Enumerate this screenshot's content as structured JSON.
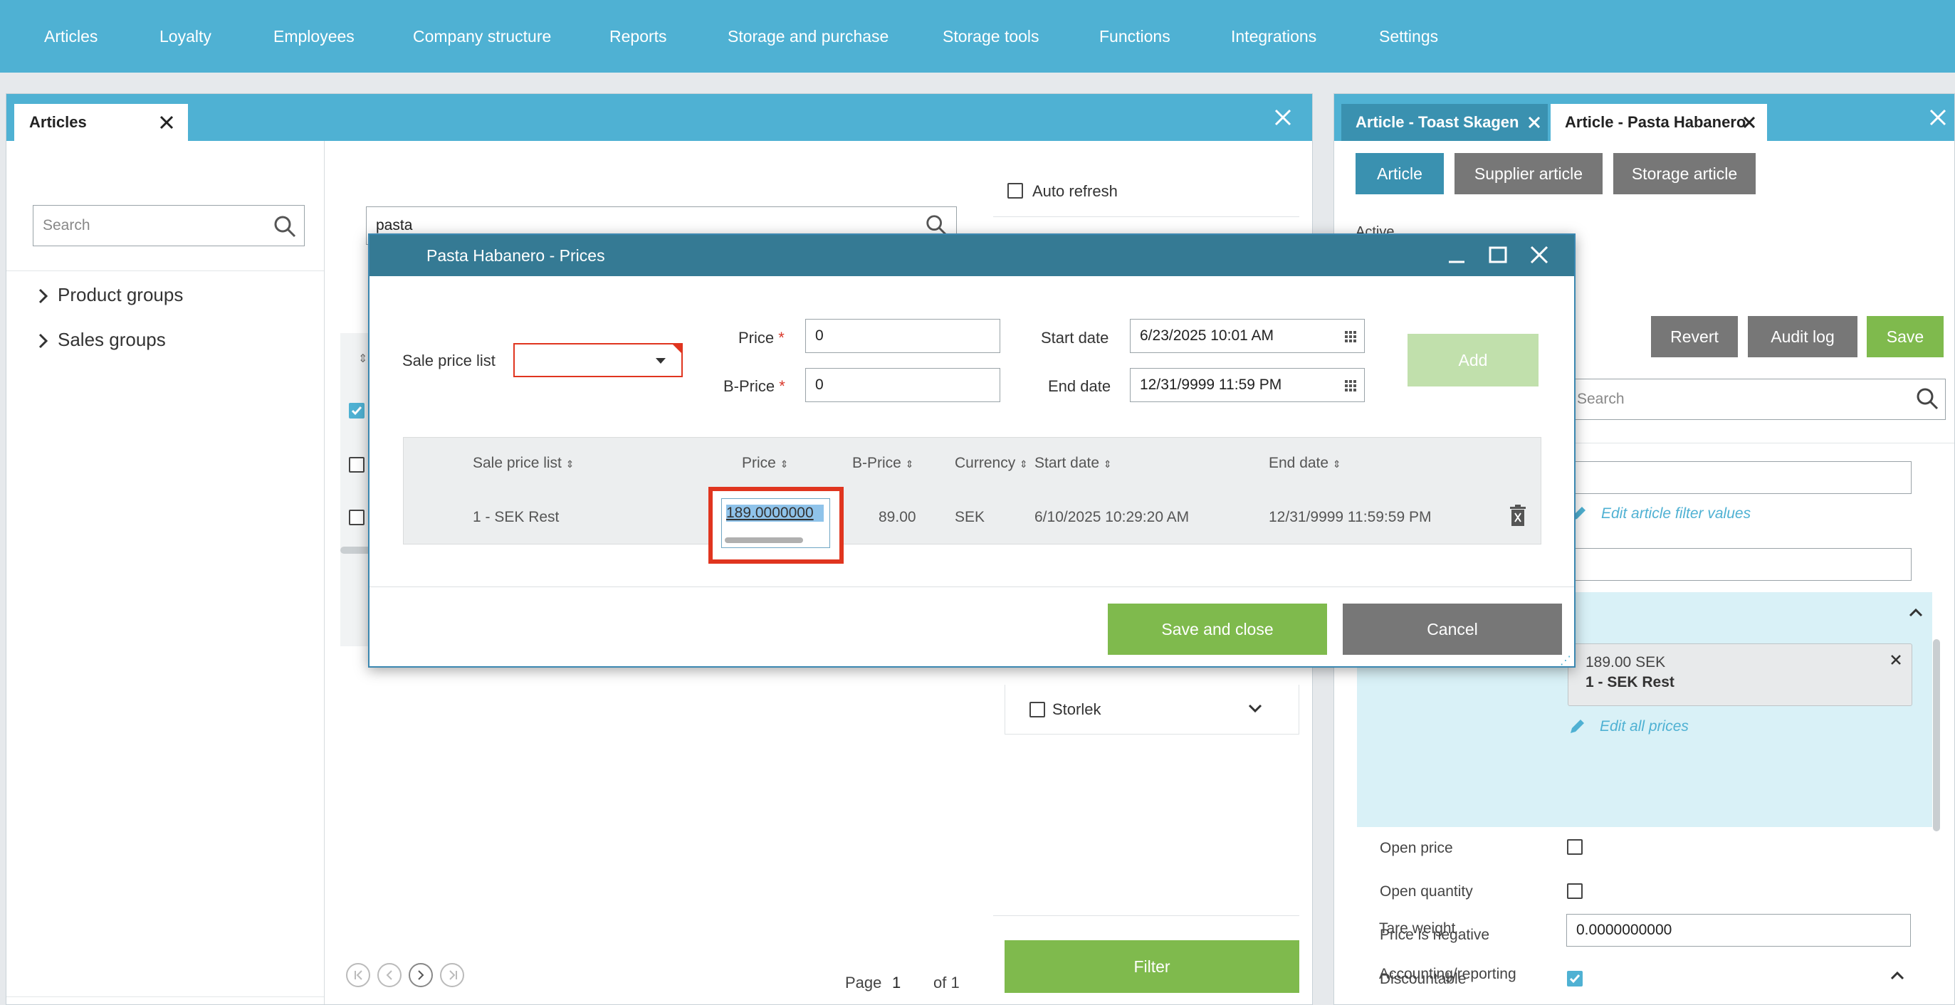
{
  "nav": [
    "Articles",
    "Loyalty",
    "Employees",
    "Company structure",
    "Reports",
    "Storage and purchase",
    "Storage tools",
    "Functions",
    "Integrations",
    "Settings"
  ],
  "left_panel": {
    "tab": "Articles",
    "tree_search_placeholder": "Search",
    "tree": [
      "Product groups",
      "Sales groups"
    ],
    "list_search_value": "pasta",
    "auto_refresh": "Auto refresh",
    "filter_storlek": "Storlek",
    "filter_button": "Filter",
    "pager": {
      "page_label": "Page",
      "page": "1",
      "of": "of 1"
    }
  },
  "right_panel": {
    "tabs": [
      "Article - Toast Skagen",
      "Article - Pasta Habanero"
    ],
    "subtabs": [
      "Article",
      "Supplier article",
      "Storage article"
    ],
    "active_label": "Active",
    "revert": "Revert",
    "audit_log": "Audit log",
    "save": "Save",
    "search_placeholder": "Search",
    "edit_filter": "Edit article filter values",
    "price_card": {
      "amount": "189.00 SEK",
      "list": "1 - SEK Rest"
    },
    "edit_all_prices": "Edit all prices",
    "options": [
      {
        "label": "Open price",
        "checked": false
      },
      {
        "label": "Open quantity",
        "checked": false
      },
      {
        "label": "Price is negative",
        "checked": false
      },
      {
        "label": "Discountable",
        "checked": true
      }
    ],
    "tare_weight_label": "Tare weight",
    "tare_weight_value": "0.0000000000",
    "accounting": "Accounting/reporting"
  },
  "dialog": {
    "title": "Pasta Habanero - Prices",
    "sale_price_list_label": "Sale price list",
    "price_label": "Price",
    "price_value": "0",
    "bprice_label": "B-Price",
    "bprice_value": "0",
    "required_mark": "*",
    "start_date_label": "Start date",
    "start_date_value": "6/23/2025 10:01 AM",
    "end_date_label": "End date",
    "end_date_value": "12/31/9999 11:59 PM",
    "add": "Add",
    "columns": [
      "Sale price list",
      "Price",
      "B-Price",
      "Currency",
      "Start date",
      "End date"
    ],
    "rows": [
      {
        "list": "1 - SEK Rest",
        "price": "189.0000000",
        "bprice": "89.00",
        "currency": "SEK",
        "start": "6/10/2025 10:29:20 AM",
        "end": "12/31/9999 11:59:59 PM"
      }
    ],
    "save_close": "Save and close",
    "cancel": "Cancel"
  },
  "colors": {
    "accent": "#4fb1d3",
    "header_dark": "#357a94",
    "green": "#7fba4d",
    "gray": "#777777",
    "highlight_red": "#e0351f"
  }
}
